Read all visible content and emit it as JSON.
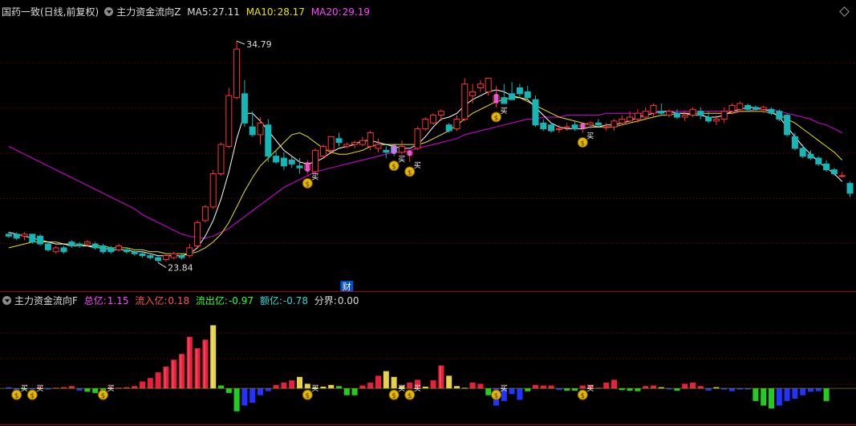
{
  "colors": {
    "up": "#ff3333",
    "down": "#17b6b6",
    "ma5": "#ffffff",
    "ma10": "#e6e600",
    "ma20": "#e000e0",
    "grid": "#8b0000",
    "sep": "#b00000",
    "text_white": "#dcdcdc",
    "text_yellow": "#e6e600",
    "text_magenta": "#ff44ff",
    "text_red": "#ff5555",
    "text_green": "#33ff33",
    "text_cyan": "#33d6d6"
  },
  "header_main": {
    "stock": "国药一致(日线,前复权)",
    "indicator": "主力资金流向Z",
    "ma5_label": "MA5:",
    "ma5_value": "27.11",
    "ma10_label": "MA10:",
    "ma10_value": "28.17",
    "ma20_label": "MA20:",
    "ma20_value": "29.19"
  },
  "header_sub": {
    "indicator": "主力资金流向F",
    "total_label": "总亿:",
    "total_value": "1.15",
    "inflow_label": "流入亿:",
    "inflow_value": "0.18",
    "outflow_label": "流出亿:",
    "outflow_value": "-0.97",
    "amount_label": "额亿:",
    "amount_value": "-0.78",
    "boundary_label": "分界:",
    "boundary_value": "0.00"
  },
  "annotations": {
    "high_label": "34.79",
    "low_label": "23.84",
    "cai_label": "财",
    "buy_glyph": "买",
    "bag_glyph": "$"
  },
  "chart_data": [
    {
      "type": "candlestick",
      "title": "主力资金流向Z",
      "ylim": [
        22.5,
        36.4
      ],
      "series_names": [
        "MA5",
        "MA10",
        "MA20"
      ],
      "ohlc": [
        [
          25.3,
          25.4,
          25.1,
          25.2
        ],
        [
          25.3,
          25.4,
          25.0,
          25.1
        ],
        [
          25.2,
          25.4,
          25.0,
          25.3
        ],
        [
          25.3,
          25.3,
          24.8,
          24.9
        ],
        [
          25.2,
          25.3,
          24.7,
          24.8
        ],
        [
          24.8,
          24.9,
          24.4,
          24.5
        ],
        [
          24.4,
          24.7,
          24.3,
          24.6
        ],
        [
          24.6,
          24.7,
          24.3,
          24.4
        ],
        [
          24.9,
          25.0,
          24.6,
          24.7
        ],
        [
          24.8,
          24.9,
          24.6,
          24.7
        ],
        [
          24.8,
          25.0,
          24.7,
          24.9
        ],
        [
          24.8,
          24.9,
          24.5,
          24.6
        ],
        [
          24.7,
          24.8,
          24.3,
          24.4
        ],
        [
          24.6,
          24.7,
          24.3,
          24.4
        ],
        [
          24.5,
          24.8,
          24.4,
          24.7
        ],
        [
          24.5,
          24.6,
          24.3,
          24.4
        ],
        [
          24.4,
          24.5,
          24.2,
          24.3
        ],
        [
          24.3,
          24.4,
          24.1,
          24.2
        ],
        [
          24.2,
          24.3,
          24.0,
          24.1
        ],
        [
          24.1,
          24.2,
          23.84,
          23.95
        ],
        [
          24.0,
          24.3,
          23.9,
          24.2
        ],
        [
          24.1,
          24.4,
          24.0,
          24.3
        ],
        [
          24.2,
          24.3,
          24.0,
          24.1
        ],
        [
          24.2,
          24.8,
          24.1,
          24.6
        ],
        [
          24.7,
          26.0,
          24.6,
          25.9
        ],
        [
          26.0,
          26.8,
          25.9,
          26.7
        ],
        [
          26.7,
          28.6,
          26.6,
          28.4
        ],
        [
          28.4,
          30.0,
          28.3,
          29.9
        ],
        [
          29.8,
          32.8,
          29.7,
          32.4
        ],
        [
          32.3,
          35.2,
          32.2,
          34.79
        ],
        [
          32.5,
          33.2,
          30.8,
          31.0
        ],
        [
          30.8,
          31.6,
          30.3,
          30.4
        ],
        [
          30.4,
          31.3,
          29.9,
          31.0
        ],
        [
          30.9,
          31.2,
          29.0,
          29.3
        ],
        [
          29.3,
          29.6,
          28.9,
          29.0
        ],
        [
          29.2,
          29.5,
          28.6,
          28.8
        ],
        [
          29.1,
          29.3,
          28.7,
          28.9
        ],
        [
          28.8,
          29.2,
          28.4,
          28.7
        ],
        [
          28.6,
          29.1,
          28.4,
          28.9
        ],
        [
          28.5,
          29.7,
          28.4,
          29.6
        ],
        [
          29.3,
          29.9,
          29.2,
          29.8
        ],
        [
          29.6,
          30.0,
          29.4,
          30.3
        ],
        [
          30.2,
          30.5,
          29.8,
          30.0
        ],
        [
          29.8,
          30.0,
          29.7,
          29.9
        ],
        [
          29.9,
          30.1,
          29.7,
          30.0
        ],
        [
          29.9,
          30.3,
          29.8,
          30.1
        ],
        [
          29.8,
          30.6,
          29.6,
          30.5
        ],
        [
          29.7,
          30.2,
          29.5,
          29.9
        ],
        [
          29.6,
          29.8,
          29.2,
          29.5
        ],
        [
          29.8,
          29.8,
          29.3,
          29.5
        ],
        [
          29.5,
          30.1,
          29.4,
          29.8
        ],
        [
          29.4,
          29.6,
          29.0,
          29.5
        ],
        [
          29.7,
          30.8,
          29.6,
          30.7
        ],
        [
          30.7,
          31.3,
          30.6,
          31.2
        ],
        [
          31.0,
          31.5,
          30.9,
          31.4
        ],
        [
          31.4,
          31.7,
          31.1,
          31.6
        ],
        [
          30.9,
          31.0,
          30.5,
          30.6
        ],
        [
          30.7,
          31.4,
          30.6,
          31.2
        ],
        [
          31.2,
          33.3,
          31.1,
          33.0
        ],
        [
          32.4,
          33.0,
          32.0,
          32.6
        ],
        [
          32.8,
          33.2,
          32.6,
          33.0
        ],
        [
          32.6,
          33.3,
          32.4,
          33.3
        ],
        [
          32.1,
          32.9,
          31.8,
          32.4
        ],
        [
          32.3,
          33.0,
          32.0,
          32.0
        ],
        [
          32.5,
          33.1,
          32.2,
          32.2
        ],
        [
          32.8,
          33.0,
          32.3,
          32.5
        ],
        [
          32.6,
          32.9,
          32.2,
          32.3
        ],
        [
          32.2,
          32.4,
          30.8,
          30.9
        ],
        [
          31.0,
          31.2,
          30.6,
          30.7
        ],
        [
          30.9,
          31.0,
          30.5,
          30.6
        ],
        [
          30.7,
          30.9,
          30.5,
          30.7
        ],
        [
          30.8,
          31.0,
          30.6,
          30.8
        ],
        [
          30.9,
          31.1,
          30.6,
          30.7
        ],
        [
          30.8,
          31.0,
          30.5,
          30.9
        ],
        [
          30.9,
          31.1,
          30.7,
          31.0
        ],
        [
          31.0,
          31.2,
          30.8,
          30.9
        ],
        [
          30.8,
          31.0,
          30.6,
          30.8
        ],
        [
          30.8,
          31.2,
          30.6,
          31.1
        ],
        [
          31.0,
          31.4,
          30.9,
          31.2
        ],
        [
          31.1,
          31.6,
          31.0,
          31.3
        ],
        [
          31.2,
          31.7,
          31.0,
          31.5
        ],
        [
          31.3,
          31.8,
          31.2,
          31.6
        ],
        [
          31.5,
          32.0,
          31.3,
          31.9
        ],
        [
          31.6,
          32.0,
          31.4,
          31.5
        ],
        [
          31.4,
          31.7,
          31.3,
          31.6
        ],
        [
          31.5,
          31.7,
          31.2,
          31.3
        ],
        [
          31.3,
          31.6,
          31.1,
          31.4
        ],
        [
          31.4,
          31.8,
          31.3,
          31.7
        ],
        [
          31.6,
          31.8,
          31.2,
          31.4
        ],
        [
          31.3,
          31.6,
          31.0,
          31.1
        ],
        [
          31.1,
          31.4,
          30.9,
          31.2
        ],
        [
          31.2,
          31.8,
          31.0,
          31.6
        ],
        [
          31.6,
          32.0,
          31.5,
          31.9
        ],
        [
          31.7,
          32.1,
          31.6,
          32.0
        ],
        [
          31.9,
          32.0,
          31.6,
          31.7
        ],
        [
          31.8,
          31.9,
          31.6,
          31.7
        ],
        [
          31.7,
          31.9,
          31.5,
          31.8
        ],
        [
          31.7,
          31.8,
          31.4,
          31.5
        ],
        [
          31.6,
          31.7,
          31.1,
          31.2
        ],
        [
          31.4,
          31.5,
          30.3,
          30.4
        ],
        [
          30.3,
          30.5,
          29.6,
          29.7
        ],
        [
          29.7,
          29.9,
          29.2,
          29.3
        ],
        [
          29.4,
          29.6,
          29.1,
          29.2
        ],
        [
          29.2,
          29.3,
          28.8,
          28.9
        ],
        [
          28.9,
          29.1,
          28.5,
          28.6
        ],
        [
          28.6,
          28.7,
          28.3,
          28.4
        ],
        [
          28.3,
          28.5,
          28.2,
          28.3
        ],
        [
          27.9,
          28.0,
          27.2,
          27.4
        ]
      ],
      "ma5": [
        25.4,
        25.3,
        25.2,
        25.1,
        25.0,
        24.9,
        24.8,
        24.8,
        24.7,
        24.7,
        24.7,
        24.6,
        24.6,
        24.5,
        24.5,
        24.5,
        24.4,
        24.4,
        24.3,
        24.2,
        24.2,
        24.2,
        24.2,
        24.3,
        24.6,
        25.2,
        26.0,
        27.1,
        28.5,
        30.2,
        31.5,
        31.5,
        31.1,
        30.6,
        30.1,
        29.6,
        29.3,
        29.0,
        28.9,
        29.0,
        29.2,
        29.5,
        29.7,
        29.8,
        29.9,
        30.1,
        30.1,
        30.0,
        29.9,
        29.8,
        29.7,
        29.7,
        29.9,
        30.3,
        30.8,
        31.2,
        31.3,
        31.5,
        31.9,
        32.2,
        32.4,
        32.6,
        32.7,
        32.6,
        32.4,
        32.3,
        32.2,
        31.8,
        31.4,
        31.0,
        30.8,
        30.7,
        30.7,
        30.7,
        30.8,
        30.8,
        30.9,
        30.9,
        31.0,
        31.1,
        31.3,
        31.4,
        31.5,
        31.6,
        31.6,
        31.5,
        31.5,
        31.4,
        31.4,
        31.3,
        31.3,
        31.4,
        31.6,
        31.7,
        31.8,
        31.8,
        31.7,
        31.6,
        31.3,
        30.8,
        30.3,
        29.8,
        29.4,
        29.0,
        28.7,
        28.4,
        28.0
      ],
      "ma10": [
        24.6,
        24.7,
        24.8,
        24.9,
        24.9,
        24.9,
        24.9,
        24.8,
        24.8,
        24.8,
        24.7,
        24.7,
        24.7,
        24.6,
        24.6,
        24.6,
        24.5,
        24.5,
        24.4,
        24.4,
        24.3,
        24.3,
        24.3,
        24.3,
        24.4,
        24.6,
        24.9,
        25.3,
        25.9,
        26.7,
        27.5,
        28.2,
        28.8,
        29.2,
        29.6,
        30.0,
        30.4,
        30.5,
        30.3,
        30.0,
        29.7,
        29.5,
        29.4,
        29.4,
        29.5,
        29.6,
        29.8,
        29.9,
        29.9,
        29.9,
        29.9,
        29.9,
        29.9,
        30.0,
        30.2,
        30.4,
        30.6,
        30.9,
        31.2,
        31.5,
        31.7,
        31.9,
        32.1,
        32.2,
        32.3,
        32.3,
        32.1,
        31.9,
        31.7,
        31.5,
        31.3,
        31.2,
        31.1,
        31.0,
        30.9,
        30.8,
        30.8,
        30.8,
        30.9,
        31.0,
        31.1,
        31.2,
        31.3,
        31.4,
        31.4,
        31.5,
        31.5,
        31.5,
        31.5,
        31.5,
        31.5,
        31.5,
        31.5,
        31.6,
        31.6,
        31.6,
        31.6,
        31.5,
        31.4,
        31.2,
        31.0,
        30.7,
        30.4,
        30.1,
        29.8,
        29.5,
        29.1
      ],
      "ma20": [
        29.8,
        29.6,
        29.4,
        29.2,
        29.0,
        28.8,
        28.6,
        28.4,
        28.2,
        28.0,
        27.8,
        27.6,
        27.4,
        27.2,
        27.0,
        26.8,
        26.6,
        26.3,
        26.1,
        25.9,
        25.7,
        25.5,
        25.3,
        25.2,
        25.1,
        25.1,
        25.2,
        25.4,
        25.6,
        25.9,
        26.2,
        26.5,
        26.8,
        27.1,
        27.4,
        27.7,
        27.9,
        28.1,
        28.3,
        28.5,
        28.6,
        28.7,
        28.8,
        28.9,
        29.0,
        29.1,
        29.2,
        29.3,
        29.4,
        29.5,
        29.5,
        29.6,
        29.7,
        29.8,
        29.9,
        30.0,
        30.1,
        30.2,
        30.4,
        30.5,
        30.6,
        30.7,
        30.8,
        30.9,
        31.0,
        31.1,
        31.2,
        31.2,
        31.3,
        31.3,
        31.3,
        31.4,
        31.4,
        31.4,
        31.4,
        31.4,
        31.5,
        31.5,
        31.5,
        31.5,
        31.5,
        31.5,
        31.6,
        31.6,
        31.6,
        31.6,
        31.6,
        31.6,
        31.6,
        31.6,
        31.6,
        31.6,
        31.6,
        31.6,
        31.6,
        31.7,
        31.7,
        31.7,
        31.6,
        31.5,
        31.4,
        31.3,
        31.2,
        31.0,
        30.9,
        30.7,
        30.5
      ],
      "buy_signals": [
        38,
        49,
        51,
        62,
        73
      ]
    },
    {
      "type": "bar",
      "title": "主力资金流向F",
      "ylim": [
        -0.6,
        1.4
      ],
      "values": [
        0.02,
        -0.06,
        -0.02,
        -0.02,
        0.02,
        -0.02,
        0.01,
        0.02,
        0.04,
        -0.04,
        -0.06,
        -0.08,
        -0.08,
        0.02,
        0.01,
        0.02,
        0.04,
        0.12,
        0.18,
        0.28,
        0.38,
        0.5,
        0.6,
        0.9,
        0.7,
        0.85,
        1.1,
        0.05,
        -0.08,
        -0.4,
        -0.3,
        -0.25,
        -0.12,
        -0.05,
        0.06,
        0.1,
        0.14,
        0.2,
        0.08,
        0.02,
        0.03,
        0.06,
        0.04,
        -0.12,
        -0.12,
        0.05,
        0.1,
        0.22,
        0.3,
        0.2,
        0.04,
        0.1,
        0.15,
        0.03,
        0.14,
        0.4,
        0.22,
        0.04,
        0.01,
        0.1,
        0.08,
        -0.12,
        -0.3,
        -0.22,
        -0.1,
        -0.2,
        -0.05,
        0.06,
        0.05,
        0.05,
        -0.03,
        -0.04,
        -0.04,
        0.05,
        0.05,
        0.01,
        0.1,
        0.15,
        -0.03,
        -0.04,
        -0.05,
        0.04,
        0.05,
        0.02,
        -0.02,
        -0.04,
        0.08,
        0.1,
        0.04,
        -0.04,
        0.02,
        -0.02,
        -0.05,
        -0.02,
        -0.02,
        -0.22,
        -0.3,
        -0.35,
        -0.3,
        -0.22,
        -0.18,
        -0.12,
        -0.06,
        -0.05,
        -0.22
      ],
      "colors": [
        "b",
        "b",
        "g",
        "b",
        "r",
        "b",
        "r",
        "r",
        "r",
        "b",
        "g",
        "g",
        "g",
        "r",
        "r",
        "r",
        "r",
        "r",
        "r",
        "r",
        "r",
        "r",
        "r",
        "r",
        "r",
        "r",
        "y",
        "g",
        "g",
        "g",
        "b",
        "b",
        "b",
        "b",
        "r",
        "r",
        "r",
        "y",
        "y",
        "y",
        "y",
        "y",
        "g",
        "g",
        "g",
        "r",
        "r",
        "r",
        "y",
        "y",
        "y",
        "r",
        "r",
        "y",
        "r",
        "r",
        "y",
        "y",
        "y",
        "r",
        "r",
        "g",
        "b",
        "b",
        "b",
        "b",
        "g",
        "r",
        "r",
        "r",
        "b",
        "g",
        "g",
        "r",
        "r",
        "r",
        "r",
        "r",
        "g",
        "g",
        "g",
        "r",
        "r",
        "y",
        "b",
        "g",
        "r",
        "r",
        "r",
        "b",
        "y",
        "b",
        "b",
        "b",
        "b",
        "g",
        "g",
        "g",
        "b",
        "b",
        "b",
        "b",
        "b",
        "b",
        "g"
      ],
      "buy_signals": [
        1,
        3,
        12
      ]
    }
  ]
}
